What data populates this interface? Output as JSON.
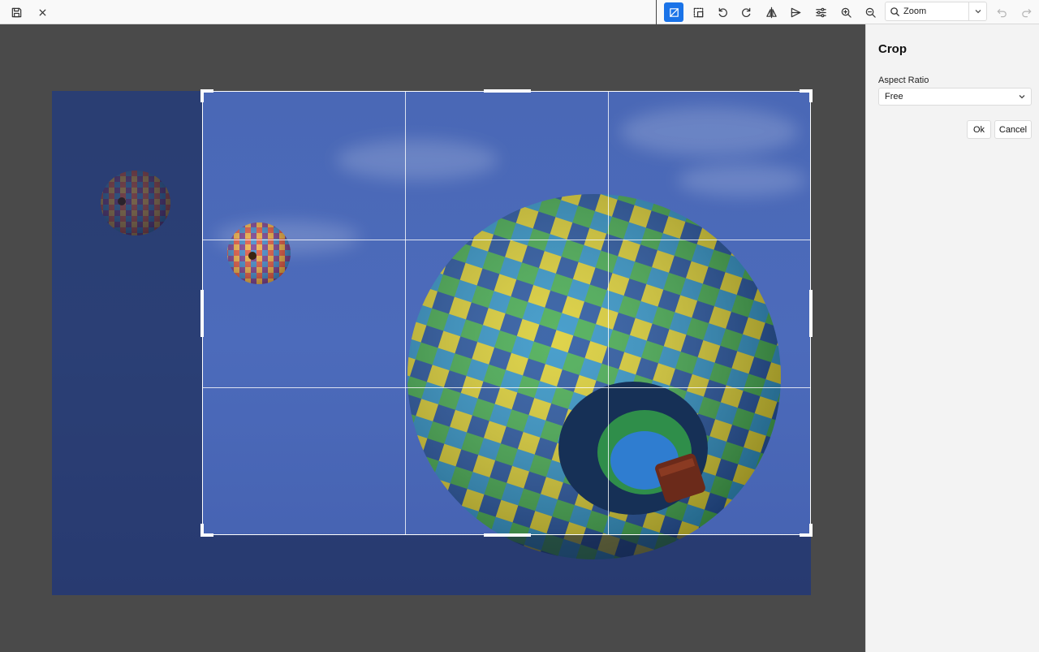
{
  "toolbar": {
    "left_icons": [
      "save-icon",
      "close-icon"
    ],
    "tools": [
      "crop-icon",
      "resize-icon",
      "rotate-left-icon",
      "rotate-right-icon",
      "flip-icon",
      "annotate-icon",
      "adjust-icon",
      "zoom-in-icon",
      "zoom-out-icon"
    ],
    "zoom": {
      "label": "Zoom"
    },
    "history": [
      "undo-icon",
      "redo-icon"
    ],
    "accent_color": "#1a73e8"
  },
  "panel": {
    "title": "Crop",
    "aspect_ratio_label": "Aspect Ratio",
    "aspect_ratio_value": "Free",
    "ok_label": "Ok",
    "cancel_label": "Cancel"
  }
}
